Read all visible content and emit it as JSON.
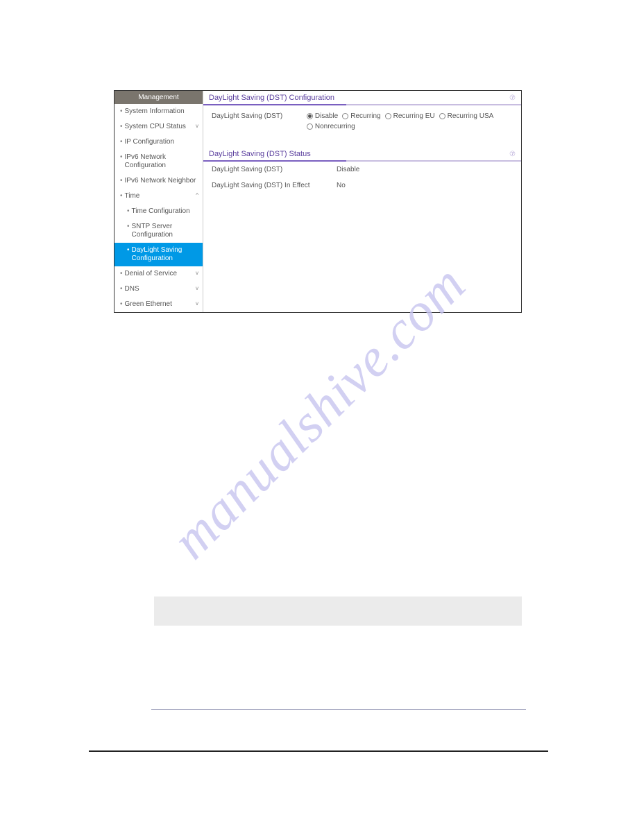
{
  "watermark": "manualshive.com",
  "sidebar": {
    "header": "Management",
    "items": [
      {
        "label": "System Information",
        "level": 0,
        "chev": ""
      },
      {
        "label": "System CPU Status",
        "level": 0,
        "chev": "v"
      },
      {
        "label": "IP Configuration",
        "level": 0,
        "chev": ""
      },
      {
        "label": "IPv6 Network Configuration",
        "level": 0,
        "chev": ""
      },
      {
        "label": "IPv6 Network Neighbor",
        "level": 0,
        "chev": ""
      },
      {
        "label": "Time",
        "level": 0,
        "chev": "^"
      },
      {
        "label": "Time Configuration",
        "level": 1,
        "chev": ""
      },
      {
        "label": "SNTP Server Configuration",
        "level": 1,
        "chev": ""
      },
      {
        "label": "DayLight Saving Configuration",
        "level": 1,
        "chev": "",
        "active": true
      },
      {
        "label": "Denial of Service",
        "level": 0,
        "chev": "v"
      },
      {
        "label": "DNS",
        "level": 0,
        "chev": "v"
      },
      {
        "label": "Green Ethernet",
        "level": 0,
        "chev": "v"
      }
    ]
  },
  "config": {
    "title": "DayLight Saving (DST) Configuration",
    "fieldLabel": "DayLight Saving (DST)",
    "help": "⑦",
    "options": [
      {
        "label": "Disable",
        "selected": true
      },
      {
        "label": "Recurring",
        "selected": false
      },
      {
        "label": "Recurring EU",
        "selected": false
      },
      {
        "label": "Recurring USA",
        "selected": false
      },
      {
        "label": "Nonrecurring",
        "selected": false
      }
    ]
  },
  "status": {
    "title": "DayLight Saving (DST) Status",
    "help": "⑦",
    "rows": [
      {
        "label": "DayLight Saving (DST)",
        "value": "Disable"
      },
      {
        "label": "DayLight Saving (DST) In Effect",
        "value": "No"
      }
    ]
  }
}
